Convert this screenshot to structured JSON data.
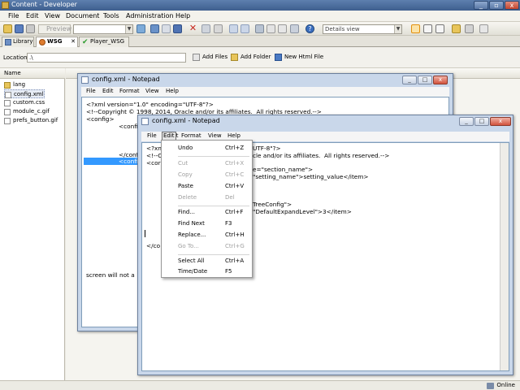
{
  "app": {
    "title": "Content - Developer",
    "menu": [
      "File",
      "Edit",
      "View",
      "Document",
      "Tools",
      "Administration",
      "Help"
    ],
    "toolbar": {
      "preview_label": "Preview",
      "view_select": "Details view"
    },
    "tabs": [
      {
        "label": "Library"
      },
      {
        "label": "WSG"
      },
      {
        "label": "Player_WSG"
      }
    ],
    "tab_close": "✕",
    "location": {
      "label": "Location:",
      "value": ".\\"
    },
    "buttons": {
      "add_files": "Add Files",
      "add_folder": "Add Folder",
      "new_html_file": "New Html File"
    },
    "sidebar": {
      "header": "Name",
      "files": [
        "lang",
        "config.xml",
        "custom.css",
        "module_c.gif",
        "prefs_button.gif"
      ]
    },
    "status": "Online"
  },
  "notepad_back": {
    "title": "config.xml - Notepad",
    "menu": [
      "File",
      "Edit",
      "Format",
      "View",
      "Help"
    ],
    "lines": [
      "<?xml version=\"1.0\" encoding=\"UTF-8\"?>",
      "<!--Copyright © 1998, 2014, Oracle and/or its affiliates.  All rights reserved.-->",
      "<config>",
      "<confi",
      "</conf",
      "<confi",
      "screen will not a"
    ]
  },
  "notepad_front": {
    "title": "config.xml - Notepad",
    "menu": [
      "File",
      "Edit",
      "Format",
      "View",
      "Help"
    ],
    "lines": [
      "<?xn",
      "<!--C",
      "<cor",
      "e=\"section_name\">",
      "\"setting_name\">setting_value</item>",
      "TreeConfig\">",
      "\"DefaultExpandLevel\">3</item>",
      "</co",
      "UTF-8\"?>",
      "cle and/or its affiliates.  All rights reserved.-->"
    ]
  },
  "edit_menu": [
    {
      "label": "Undo",
      "shortcut": "Ctrl+Z",
      "enabled": true
    },
    {
      "label": "Cut",
      "shortcut": "Ctrl+X",
      "enabled": false
    },
    {
      "label": "Copy",
      "shortcut": "Ctrl+C",
      "enabled": false
    },
    {
      "label": "Paste",
      "shortcut": "Ctrl+V",
      "enabled": true
    },
    {
      "label": "Delete",
      "shortcut": "Del",
      "enabled": false
    },
    {
      "label": "Find...",
      "shortcut": "Ctrl+F",
      "enabled": true
    },
    {
      "label": "Find Next",
      "shortcut": "F3",
      "enabled": true
    },
    {
      "label": "Replace...",
      "shortcut": "Ctrl+H",
      "enabled": true
    },
    {
      "label": "Go To...",
      "shortcut": "Ctrl+G",
      "enabled": false
    },
    {
      "label": "Select All",
      "shortcut": "Ctrl+A",
      "enabled": true
    },
    {
      "label": "Time/Date",
      "shortcut": "F5",
      "enabled": true
    }
  ]
}
